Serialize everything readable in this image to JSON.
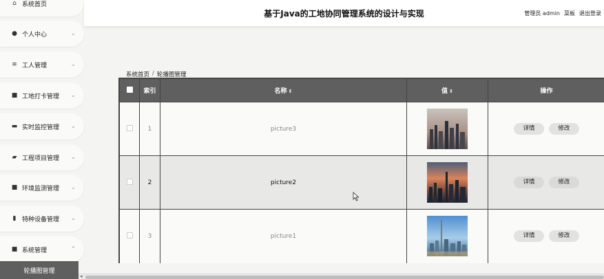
{
  "sidebar": {
    "items": [
      {
        "label": "系统首页",
        "icon": "home-icon",
        "glyph": "⌂",
        "chevron": ""
      },
      {
        "label": "个人中心",
        "icon": "user-icon",
        "glyph": "●",
        "chevron": "⌄"
      },
      {
        "label": "工人管理",
        "icon": "list-icon",
        "glyph": "≡",
        "chevron": "⌄"
      },
      {
        "label": "工地打卡管理",
        "icon": "grid-icon",
        "glyph": "■",
        "chevron": "⌄"
      },
      {
        "label": "实时监控管理",
        "icon": "chat-icon",
        "glyph": "▬",
        "chevron": "⌄"
      },
      {
        "label": "工程项目管理",
        "icon": "briefcase-icon",
        "glyph": "▰",
        "chevron": "⌄"
      },
      {
        "label": "环境监测管理",
        "icon": "grid-icon",
        "glyph": "■",
        "chevron": "⌄"
      },
      {
        "label": "特种设备管理",
        "icon": "bar-chart-icon",
        "glyph": "▮",
        "chevron": "⌄"
      },
      {
        "label": "系统管理",
        "icon": "grid-icon",
        "glyph": "■",
        "chevron": "⌃"
      }
    ],
    "active_sub": "轮播图管理"
  },
  "header": {
    "title": "基于Java的工地协同管理系统的设计与实现",
    "user_label": "管理员 admin",
    "menu_label": "菜板",
    "logout_label": "退出登录"
  },
  "breadcrumb": {
    "home": "系统首页",
    "separator": "/",
    "current": "轮播图管理"
  },
  "table": {
    "headers": {
      "index": "索引",
      "name": "名称",
      "value": "值",
      "actions": "操作"
    },
    "sort_glyph": "⇕",
    "rows": [
      {
        "index": "1",
        "name": "picture3",
        "detail": "详情",
        "edit": "修改"
      },
      {
        "index": "2",
        "name": "picture2",
        "detail": "详情",
        "edit": "修改"
      },
      {
        "index": "3",
        "name": "picture1",
        "detail": "详情",
        "edit": "修改"
      }
    ]
  }
}
